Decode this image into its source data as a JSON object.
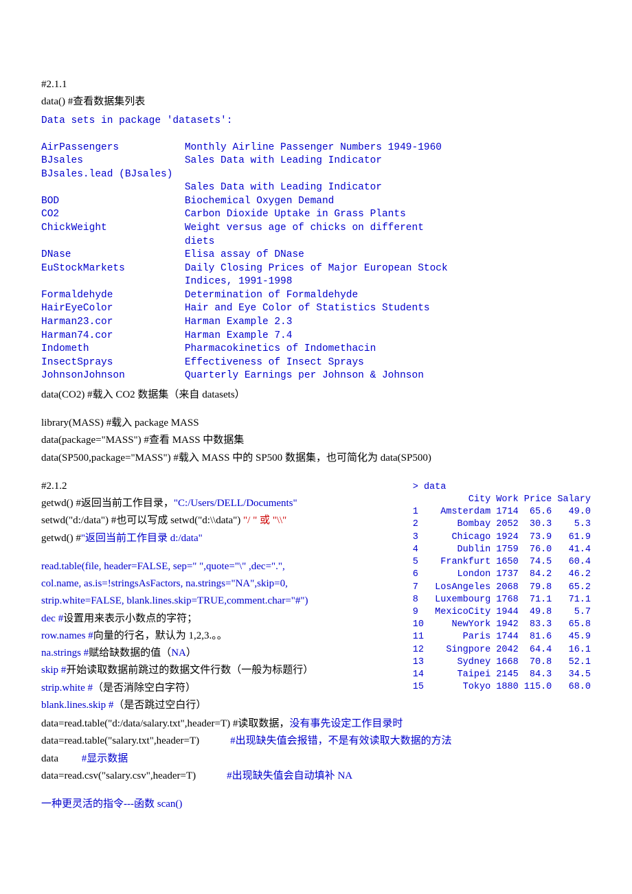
{
  "l1": "#2.1.1",
  "l2a": "data()    #",
  "l2b": "查看数据集列表",
  "datasets_block": "Data sets in package 'datasets':\n\nAirPassengers           Monthly Airline Passenger Numbers 1949-1960\nBJsales                 Sales Data with Leading Indicator\nBJsales.lead (BJsales)\n                        Sales Data with Leading Indicator\nBOD                     Biochemical Oxygen Demand\nCO2                     Carbon Dioxide Uptake in Grass Plants\nChickWeight             Weight versus age of chicks on different\n                        diets\nDNase                   Elisa assay of DNase\nEuStockMarkets          Daily Closing Prices of Major European Stock\n                        Indices, 1991-1998\nFormaldehyde            Determination of Formaldehyde\nHairEyeColor            Hair and Eye Color of Statistics Students\nHarman23.cor            Harman Example 2.3\nHarman74.cor            Harman Example 7.4\nIndometh                Pharmacokinetics of Indomethacin\nInsectSprays            Effectiveness of Insect Sprays\nJohnsonJohnson          Quarterly Earnings per Johnson & Johnson",
  "l3a": "data(CO2)    #",
  "l3b": "载入",
  "l3c": " CO2 ",
  "l3d": "数据集（来自",
  "l3e": " datasets",
  "l3f": "）",
  "l4a": "library(MASS)      #",
  "l4b": "载入",
  "l4c": " package MASS",
  "l5a": "data(package=\"MASS\")     #",
  "l5b": "查看",
  "l5c": " MASS ",
  "l5d": "中数据集",
  "l6a": "data(SP500,package=\"MASS\")    #",
  "l6b": "载入",
  "l6c": " MASS ",
  "l6d": "中的",
  "l6e": " SP500 ",
  "l6f": "数据集，也可简化为",
  "l6g": " data(SP500)",
  "table_block": "> data\n          City Work Price Salary\n1    Amsterdam 1714  65.6   49.0\n2       Bombay 2052  30.3    5.3\n3      Chicago 1924  73.9   61.9\n4       Dublin 1759  76.0   41.4\n5    Frankfurt 1650  74.5   60.4\n6       London 1737  84.2   46.2\n7   LosAngeles 2068  79.8   65.2\n8   Luxembourg 1768  71.1   71.1\n9   MexicoCity 1944  49.8    5.7\n10     NewYork 1942  83.3   65.8\n11       Paris 1744  81.6   45.9\n12    Singpore 2042  64.4   16.1\n13      Sydney 1668  70.8   52.1\n14      Taipei 2145  84.3   34.5\n15       Tokyo 1880 115.0   68.0",
  "l7": "#2.1.2",
  "l8a": "getwd()     #",
  "l8b": "返回当前工作目录，",
  "l8c": "\"C:/Users/DELL/Documents\"",
  "l9a": "setwd(\"d:/data\")   #",
  "l9b": "也可以写成",
  "l9c": " setwd(\"d:\\\\data\") ",
  "l9d": "\"/ \" 或 \"\\\\\"",
  "l10a": "getwd()     #",
  "l10b": "\"返回当前工作目录 d:/data\"",
  "l11": "read.table(file, header=FALSE, sep=\" \",quote=\"\\\" ,dec=\".\",",
  "l12": "col.name,   as.is=!stringsAsFactors,   na.strings=\"NA\",skip=0,",
  "l13": "strip.white=FALSE, blank.lines.skip=TRUE,comment.char=\"#\")",
  "l14a": "dec #",
  "l14b": "设置用来表示小数点的字符；",
  "l15a": "row.names #",
  "l15b": "向量的行名，默认为",
  "l15c": " 1,2,3.",
  "l15d": "。。",
  "l16a": "na.strings #",
  "l16b": "赋给缺数据的值（",
  "l16c": "NA",
  "l16d": "）",
  "l17a": "skip    #",
  "l17b": "开始读取数据前跳过的数据文件行数（一般为标题行）",
  "l18a": "strip.white #",
  "l18b": "（是否消除空白字符）",
  "l19a": "blank.lines.skip #",
  "l19b": "（是否跳过空白行）",
  "l20a": "data=read.table(\"d:/data/salary.txt\",header=T)    #",
  "l20b": "读取数据，",
  "l20c": "没有事先设定工作目录时",
  "l21a": "data=read.table(\"salary.txt\",header=T)",
  "l21b1": "#",
  "l21b": "出现缺失值会报错，不是有效读取大数据的方法",
  "l22a": "data",
  "l22b1": "#",
  "l22b": "显示数据",
  "l23a": "data=read.csv(\"salary.csv\",header=T)",
  "l23b1": "#",
  "l23b": "出现缺失值会自动填补",
  "l23c": " NA",
  "l24a": "一种更灵活的指令",
  "l24b": "---",
  "l24c": "函数",
  "l24d": " scan()"
}
